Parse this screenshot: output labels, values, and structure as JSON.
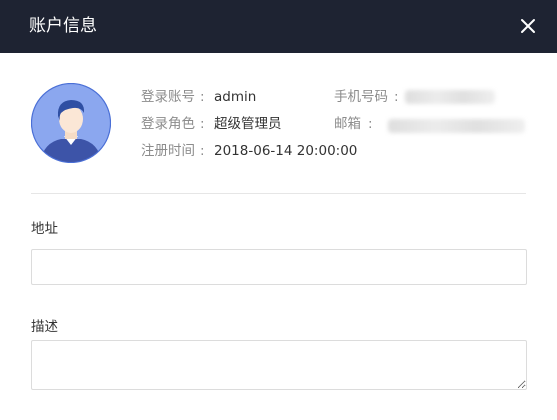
{
  "dialog": {
    "title": "账户信息",
    "close_icon": "close-icon",
    "header_color": "#1e2332"
  },
  "profile": {
    "avatar_icon": "user-avatar-icon",
    "login_account": {
      "label": "登录账号",
      "separator": ":",
      "value": "admin"
    },
    "login_role": {
      "label": "登录角色",
      "separator": ":",
      "value": "超级管理员"
    },
    "register_time": {
      "label": "注册时间",
      "separator": ":",
      "value": "2018-06-14 20:00:00"
    },
    "phone": {
      "label": "手机号码",
      "separator": ":"
    },
    "email": {
      "label": "邮箱",
      "separator": ":"
    }
  },
  "form": {
    "address": {
      "label": "地址",
      "value": "",
      "placeholder": ""
    },
    "description": {
      "label": "描述",
      "value": "",
      "placeholder": ""
    }
  }
}
